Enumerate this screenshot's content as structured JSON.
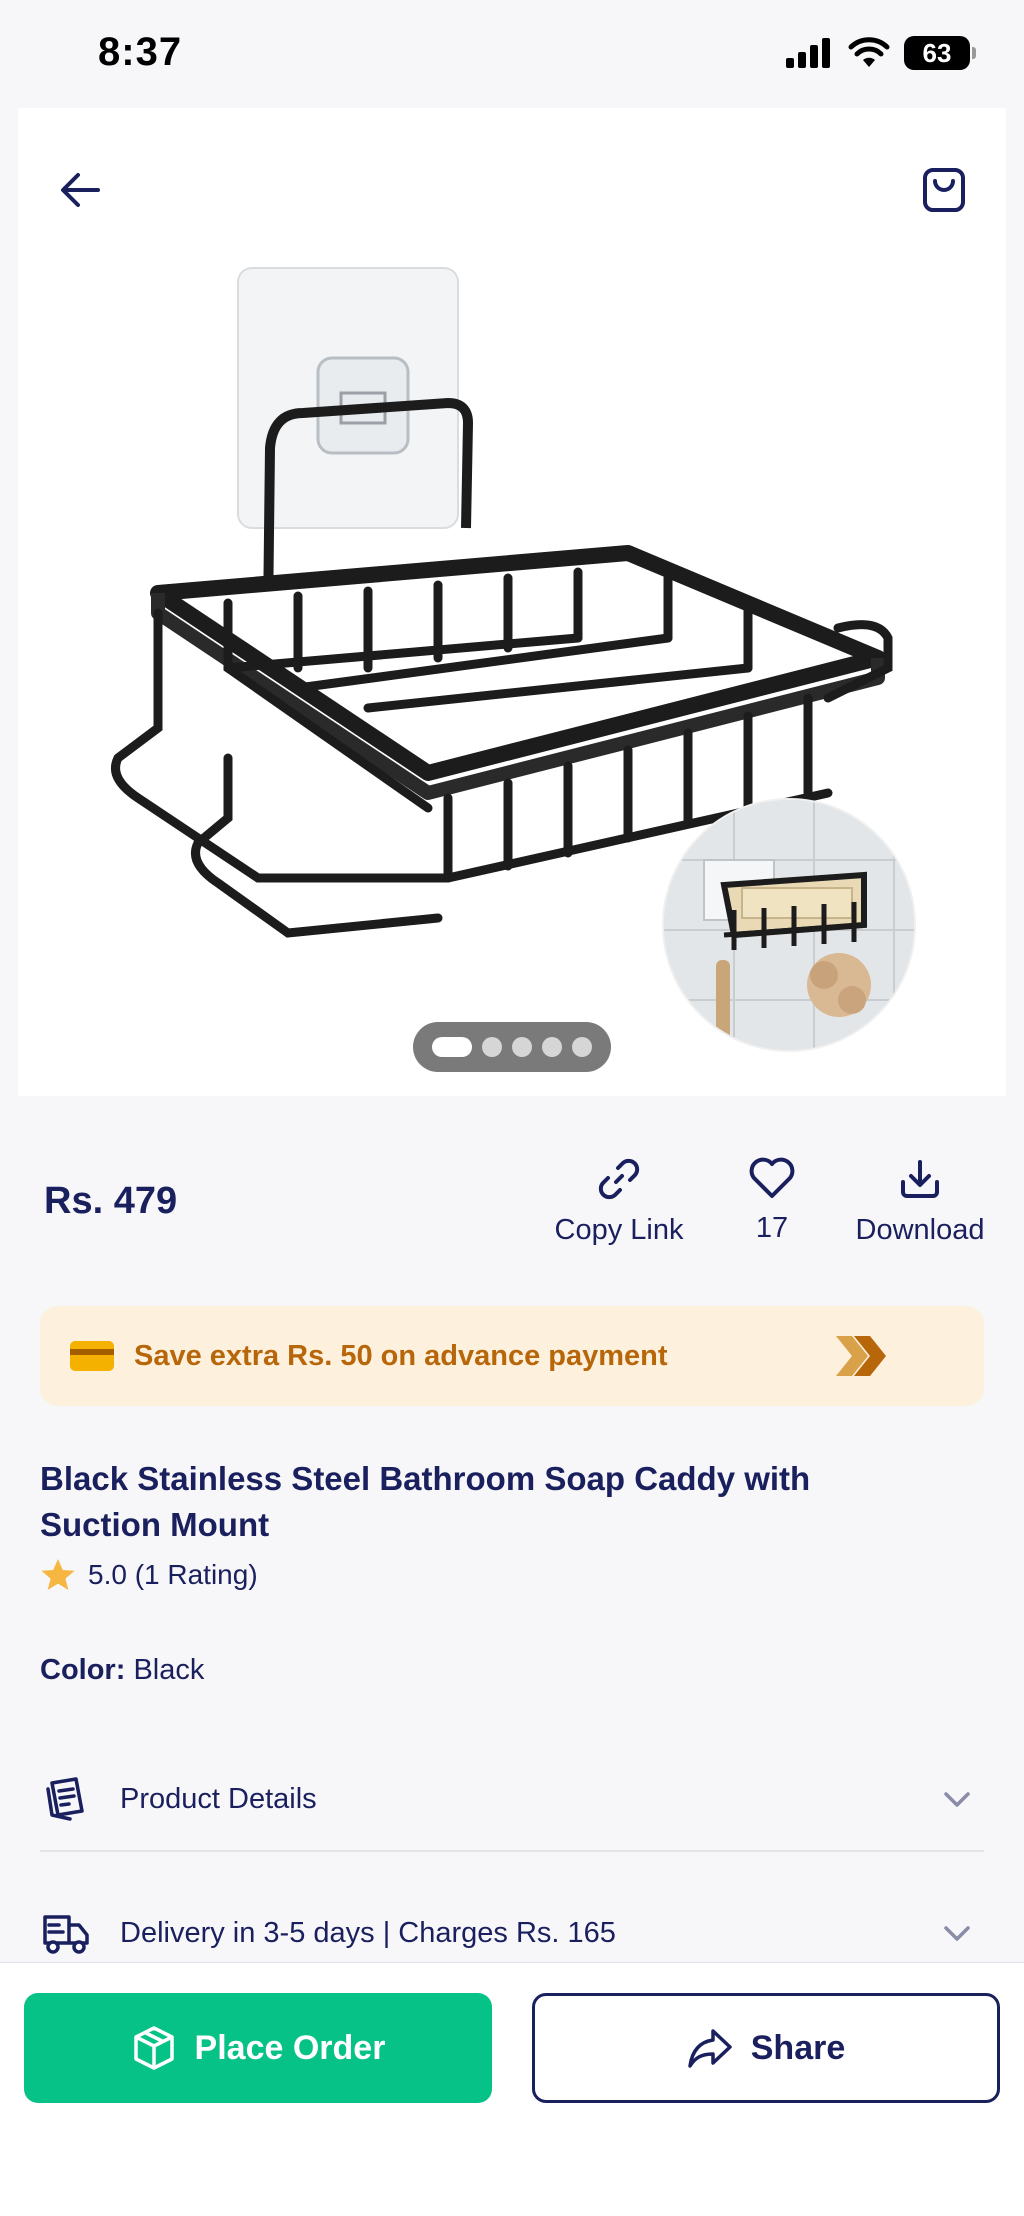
{
  "status_bar": {
    "time": "8:37",
    "battery": "63"
  },
  "product": {
    "price": "Rs. 479",
    "title": "Black Stainless Steel Bathroom Soap Caddy with Suction Mount",
    "rating_text": "5.0 (1 Rating)",
    "color_label": "Color:",
    "color_value": "Black",
    "image_count": 5,
    "active_image_index": 0
  },
  "actions": {
    "copy_link": "Copy Link",
    "likes": "17",
    "download": "Download"
  },
  "offer": {
    "text": "Save extra Rs. 50 on advance payment"
  },
  "sections": {
    "product_details": "Product Details",
    "delivery": "Delivery in 3-5 days | Charges Rs. 165"
  },
  "bottom_bar": {
    "place_order": "Place Order",
    "share": "Share"
  },
  "colors": {
    "navy": "#1a1f5e",
    "green": "#06c286",
    "offer_bg": "#fdf1de",
    "offer_text": "#b8660a",
    "star": "#f5b642"
  },
  "icons": [
    "back-arrow-icon",
    "shopping-bag-icon",
    "link-icon",
    "heart-icon",
    "download-icon",
    "credit-card-icon",
    "double-chevron-right-icon",
    "star-icon",
    "document-icon",
    "chevron-down-icon",
    "delivery-truck-icon",
    "box-icon",
    "share-arrow-icon",
    "signal-icon",
    "wifi-icon",
    "battery-icon"
  ]
}
